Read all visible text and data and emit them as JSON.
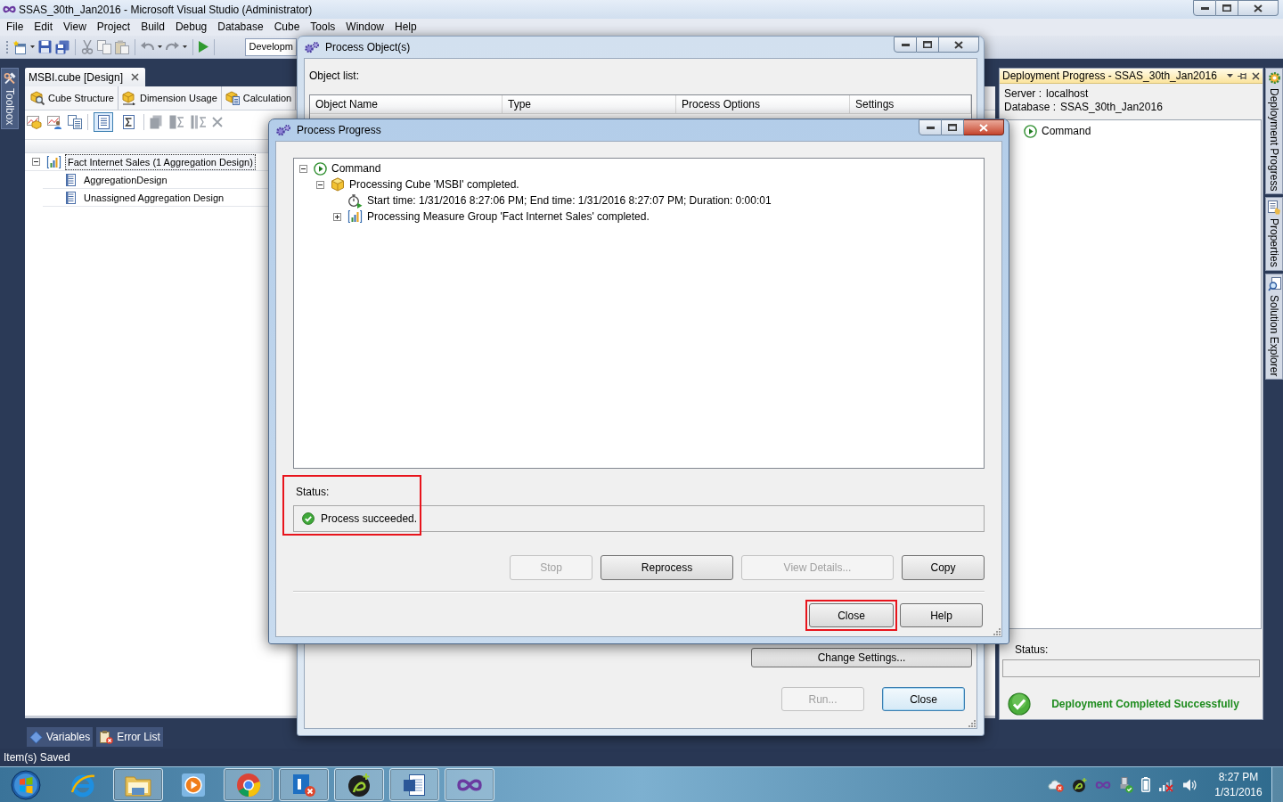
{
  "window": {
    "title": "SSAS_30th_Jan2016 - Microsoft Visual Studio (Administrator)"
  },
  "menu": [
    "File",
    "Edit",
    "View",
    "Project",
    "Build",
    "Debug",
    "Database",
    "Cube",
    "Tools",
    "Window",
    "Help"
  ],
  "toolbar": {
    "configuration": "Developm"
  },
  "toolbox_tab": {
    "label": "Toolbox"
  },
  "document": {
    "tab": {
      "label": "MSBI.cube [Design]",
      "selected": true
    },
    "designer_tabs": [
      {
        "label": "Cube Structure",
        "kind": "structure",
        "selected": false
      },
      {
        "label": "Dimension Usage",
        "kind": "usage",
        "selected": false
      },
      {
        "label": "Calculation",
        "kind": "calculation",
        "selected": false
      }
    ],
    "view_modes": [
      {
        "kind": "standard",
        "selected": true
      },
      {
        "kind": "advanced",
        "selected": false
      }
    ],
    "aggregations": [
      {
        "label": "Fact Internet Sales (1 Aggregation Design)",
        "kind": "measure_group",
        "expanded": true,
        "selected": true,
        "children": [
          {
            "label": "AggregationDesign",
            "kind": "design",
            "selected": false
          },
          {
            "label": "Unassigned Aggregation Design",
            "kind": "design",
            "selected": false
          }
        ]
      }
    ]
  },
  "bottom_tabs": [
    {
      "label": "Variables",
      "kind": "variables"
    },
    {
      "label": "Error List",
      "kind": "errors"
    }
  ],
  "status_bar": {
    "message": "Item(s) Saved"
  },
  "deployment_progress": {
    "title": "Deployment Progress - SSAS_30th_Jan2016",
    "info": [
      {
        "label": "Server :",
        "value": "localhost"
      },
      {
        "label": "Database :",
        "value": "SSAS_30th_Jan2016"
      }
    ],
    "log": [
      {
        "label": "Command",
        "kind": "command"
      }
    ],
    "status_label": "Status:",
    "result": "Deployment Completed Successfully"
  },
  "side_tabs": [
    {
      "label": "Deployment Progress",
      "kind": "deployment"
    },
    {
      "label": "Properties",
      "kind": "properties"
    },
    {
      "label": "Solution Explorer",
      "kind": "solution"
    }
  ],
  "process_objects": {
    "title": "Process Object(s)",
    "active": false,
    "list_label": "Object list:",
    "columns": [
      "Object Name",
      "Type",
      "Process Options",
      "Settings"
    ],
    "buttons": [
      {
        "label": "Change Settings...",
        "kind": "settings",
        "disabled": false,
        "default": false
      },
      {
        "label": "Run...",
        "kind": "command",
        "disabled": true,
        "default": false
      },
      {
        "label": "Close",
        "kind": "command",
        "disabled": false,
        "default": true
      }
    ]
  },
  "process_progress": {
    "title": "Process Progress",
    "active": true,
    "log": [
      {
        "label": "Command",
        "kind": "command",
        "expanded": true,
        "children": [
          {
            "label": "Processing Cube 'MSBI' completed.",
            "kind": "cube",
            "expanded": true,
            "children": [
              {
                "label": "Start time: 1/31/2016 8:27:06 PM; End time: 1/31/2016 8:27:07 PM; Duration: 0:00:01",
                "kind": "timing"
              },
              {
                "label": "Processing Measure Group 'Fact Internet Sales' completed.",
                "kind": "measure_group",
                "expanded": false
              }
            ]
          }
        ]
      }
    ],
    "status_label": "Status:",
    "status": {
      "text": "Process succeeded.",
      "highlighted": true
    },
    "actions": [
      {
        "label": "Stop",
        "disabled": true
      },
      {
        "label": "Reprocess",
        "disabled": false
      },
      {
        "label": "View Details...",
        "disabled": true
      },
      {
        "label": "Copy",
        "disabled": false
      }
    ],
    "buttons": [
      {
        "label": "Close",
        "highlighted": true
      },
      {
        "label": "Help",
        "highlighted": false
      }
    ]
  },
  "taskbar": {
    "apps": [
      {
        "kind": "e_browser",
        "running": false
      },
      {
        "kind": "folder",
        "running": true
      },
      {
        "kind": "media",
        "running": false
      },
      {
        "kind": "round_browser",
        "running": true
      },
      {
        "kind": "l_chat",
        "running": true
      },
      {
        "kind": "p_plus",
        "running": true
      },
      {
        "kind": "w_document",
        "running": true
      },
      {
        "kind": "infinity",
        "running": true
      }
    ],
    "time": "8:27 PM",
    "date": "1/31/2016"
  }
}
